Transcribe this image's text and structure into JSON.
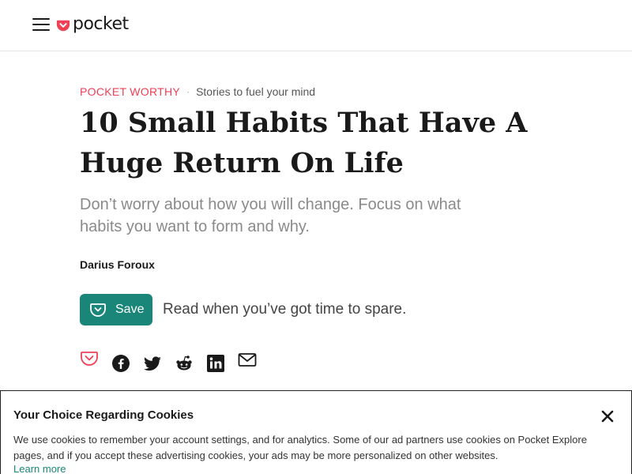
{
  "header": {
    "logo_text": "pocket",
    "menu_icon": "hamburger-menu-icon",
    "logo_icon": "pocket-logo-icon",
    "brand_color": "#ef4056"
  },
  "article": {
    "eyebrow_brand": "POCKET WORTHY",
    "eyebrow_separator": "·",
    "eyebrow_tag": "Stories to fuel your mind",
    "title": "10 Small Habits That Have A Huge Return On Life",
    "subtitle": "Don’t worry about how you will change. Focus on what habits you want to form and why.",
    "author": "Darius Foroux"
  },
  "save": {
    "button_label": "Save",
    "note": "Read when you’ve got time to spare.",
    "accent_color": "#1a8679"
  },
  "share": {
    "icons": [
      "pocket-icon",
      "facebook-icon",
      "twitter-icon",
      "reddit-icon",
      "linkedin-icon",
      "email-icon"
    ]
  },
  "cookies": {
    "title": "Your Choice Regarding Cookies",
    "text": "We use cookies to remember your account settings, and for analytics. Some of our ad partners use cookies on Pocket Explore pages, and if you accept these advertising cookies, your ads may be more personalized on other websites.",
    "link": "Learn more",
    "close_icon": "close-icon"
  }
}
